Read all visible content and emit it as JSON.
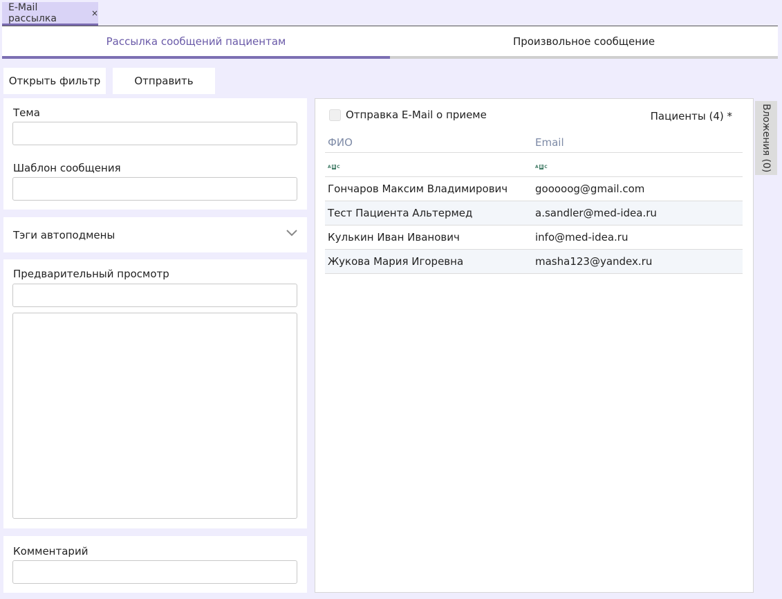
{
  "doc_tab": {
    "title": "E-Mail рассылка",
    "close": "×"
  },
  "subtabs": [
    {
      "label": "Рассылка сообщений пациентам",
      "active": true
    },
    {
      "label": "Произвольное сообщение",
      "active": false
    }
  ],
  "toolbar": {
    "open_filter": "Открыть фильтр",
    "send": "Отправить"
  },
  "form": {
    "subject_label": "Тема",
    "subject_value": "",
    "template_label": "Шаблон сообщения",
    "template_value": "",
    "tags_label": "Тэги автоподмены",
    "preview_label": "Предварительный просмотр",
    "preview_title_value": "",
    "preview_body_value": "",
    "comment_label": "Комментарий",
    "comment_value": ""
  },
  "right": {
    "checkbox_label": "Отправка E-Mail о приеме",
    "checkbox_checked": false,
    "patients_label": "Пациенты (4) *",
    "columns": [
      "ФИО",
      "Email"
    ],
    "filter_icon": "A B C",
    "rows": [
      {
        "name": "Гончаров Максим Владимирович",
        "email": "gooooog@gmail.com"
      },
      {
        "name": "Тест Пациента Альтермед",
        "email": "a.sandler@med-idea.ru"
      },
      {
        "name": "Кулькин Иван Иванович",
        "email": "info@med-idea.ru"
      },
      {
        "name": "Жукова Мария Игоревна",
        "email": "masha123@yandex.ru"
      }
    ]
  },
  "attachments_tab": "Вложения (0)",
  "colors": {
    "accent": "#7c6fb3",
    "background": "#efedfd",
    "header_text": "#7d8aa6"
  }
}
